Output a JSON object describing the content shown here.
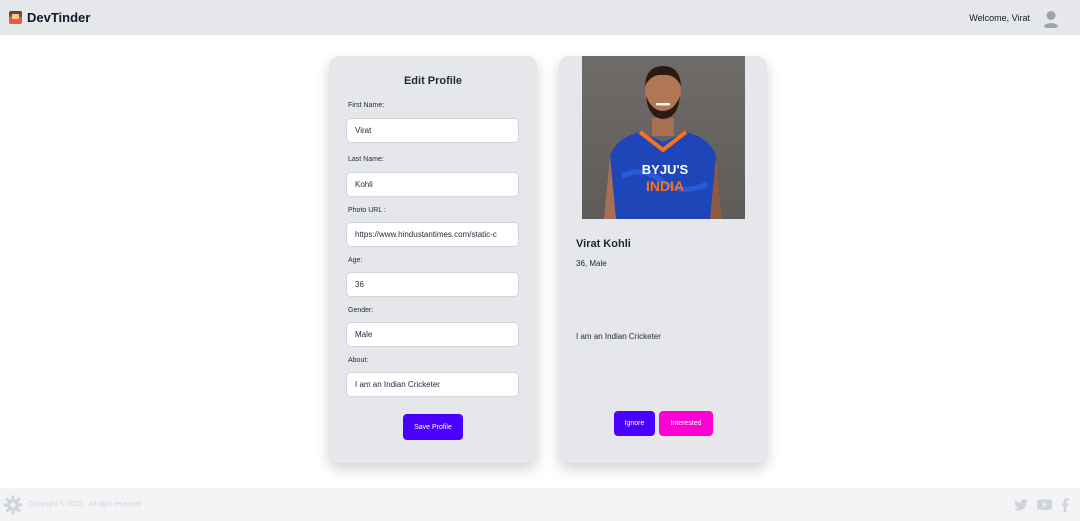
{
  "navbar": {
    "brand": "DevTinder",
    "welcome": "Welcome, Virat",
    "avatar_icon": "user-avatar-icon"
  },
  "edit_profile": {
    "title": "Edit Profile",
    "fields": {
      "first_name": {
        "label": "First Name:",
        "value": "Virat"
      },
      "last_name": {
        "label": "Last Name:",
        "value": "Kohli"
      },
      "photo_url": {
        "label": "Photo URL :",
        "value": "https://www.hindustantimes.com/static-c"
      },
      "age": {
        "label": "Age:",
        "value": "36"
      },
      "gender": {
        "label": "Gender:",
        "value": "Male"
      },
      "about": {
        "label": "About:",
        "value": "I am an Indian Cricketer"
      }
    },
    "save_label": "Save Profile"
  },
  "preview": {
    "name": "Virat Kohli",
    "meta": "36, Male",
    "about": "I am an Indian Cricketer",
    "ignore_label": "Ignore",
    "interested_label": "Interested",
    "photo_jersey_text": "BYJU'S",
    "photo_country_text": "INDIA"
  },
  "footer": {
    "copyright": "Copyright © 2025 - All right reserved",
    "icons": [
      "gear-icon",
      "twitter-icon",
      "youtube-icon",
      "facebook-icon"
    ]
  },
  "colors": {
    "primary": "#4a00ff",
    "secondary": "#ff00d3",
    "card_bg": "#e5e7eb",
    "navbar_bg": "#e5e7eb",
    "footer_bg": "#f3f4f6"
  }
}
